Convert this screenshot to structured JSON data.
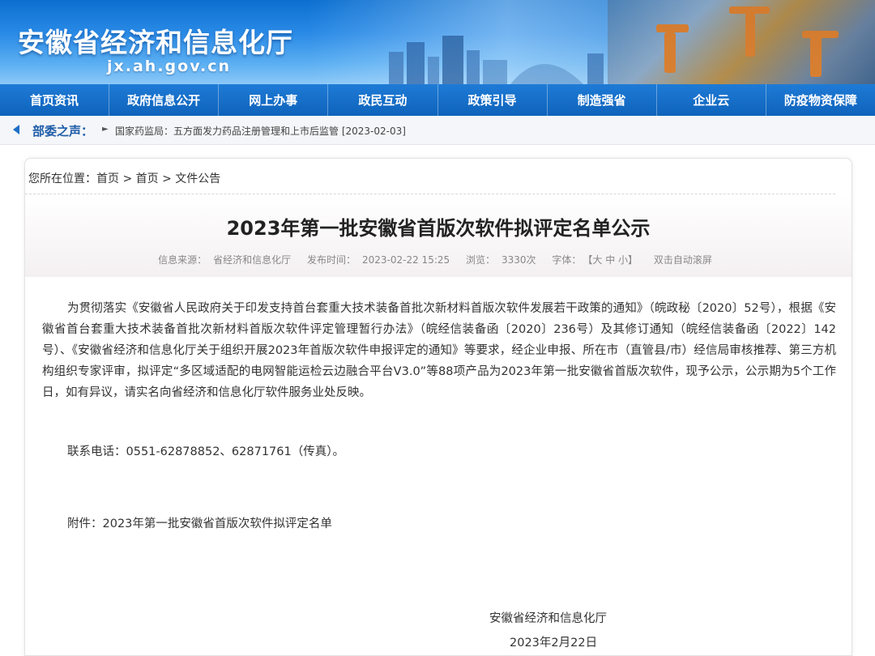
{
  "header": {
    "site_title": "安徽省经济和信息化厅",
    "site_domain": "jx.ah.gov.cn"
  },
  "nav": {
    "items": [
      "首页资讯",
      "政府信息公开",
      "网上办事",
      "政民互动",
      "政策引导",
      "制造强省",
      "企业云",
      "防疫物资保障"
    ]
  },
  "ticker": {
    "label": "部委之声：",
    "item": "国家药监局：五方面发力药品注册管理和上市后监管 [2023-02-03]"
  },
  "breadcrumb": {
    "prefix": "您所在位置：",
    "crumbs": [
      "首页",
      "首页",
      "文件公告"
    ],
    "separator": " > "
  },
  "article": {
    "title": "2023年第一批安徽省首版次软件拟评定名单公示",
    "meta": {
      "source_label": "信息来源：",
      "source": "省经济和信息化厅",
      "time_label": "发布时间：",
      "time": "2023-02-22 15:25",
      "views_label": "浏览：",
      "views": "3330次",
      "font_label": "字体：",
      "font_sizes": "【大 中 小】",
      "autoscroll": "双击自动滚屏"
    },
    "body": "为贯彻落实《安徽省人民政府关于印发支持首台套重大技术装备首批次新材料首版次软件发展若干政策的通知》（皖政秘〔2020〕52号），根据《安徽省首台套重大技术装备首批次新材料首版次软件评定管理暂行办法》（皖经信装备函〔2020〕236号）及其修订通知（皖经信装备函〔2022〕142号）、《安徽省经济和信息化厅关于组织开展2023年首版次软件申报评定的通知》等要求，经企业申报、所在市（直管县/市）经信局审核推荐、第三方机构组织专家评审，拟评定“多区域适配的电网智能运检云边融合平台V3.0”等88项产品为2023年第一批安徽省首版次软件，现予公示，公示期为5个工作日，如有异议，请实名向省经济和信息化厅软件服务业处反映。",
    "contact": "联系电话：0551-62878852、62871761（传真）。",
    "attachment": "附件：2023年第一批安徽省首版次软件拟评定名单",
    "signature_org": "安徽省经济和信息化厅",
    "signature_date": "2023年2月22日"
  },
  "colors": {
    "nav_bg": "#1670c9",
    "title_text": "#222222",
    "ticker_label": "#1e5ca8"
  }
}
